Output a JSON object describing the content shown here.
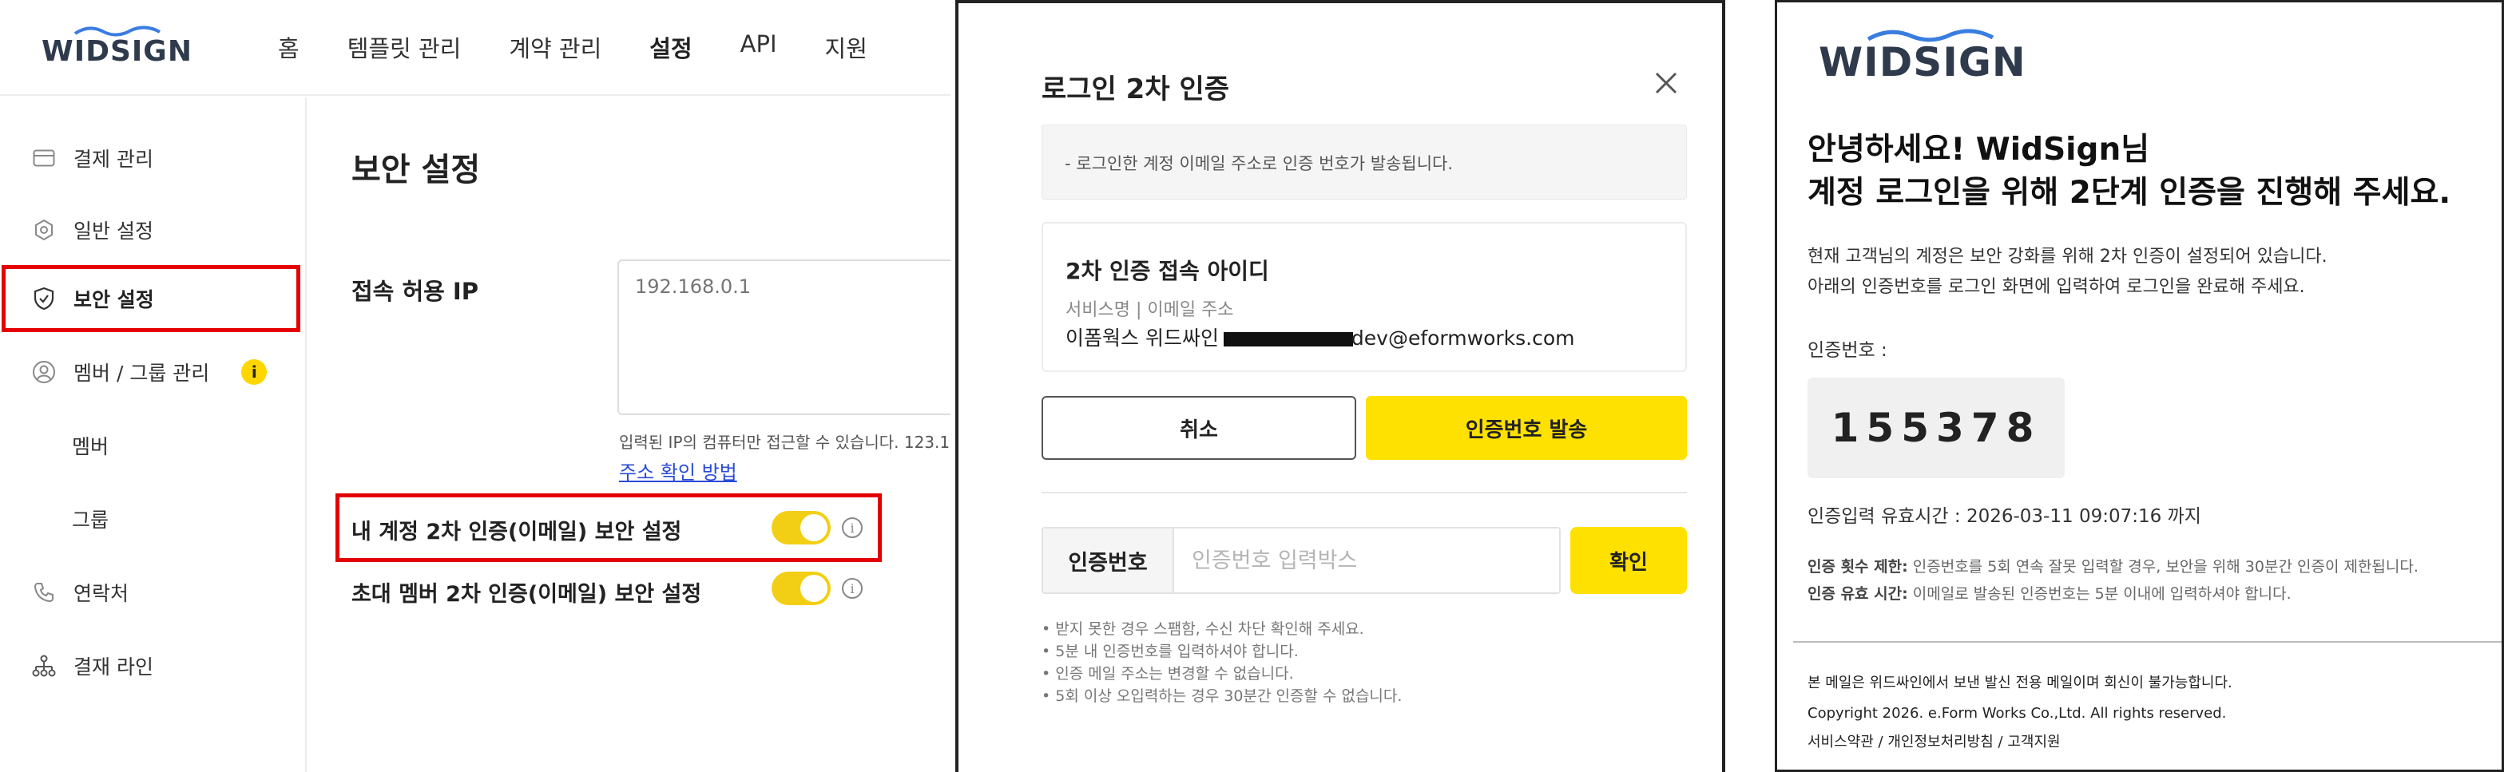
{
  "brand": {
    "name": "WIDSIGN",
    "wave_color": "#3a7de0",
    "accent": "#ffe100",
    "highlight": "#e50000"
  },
  "admin": {
    "nav": [
      "홈",
      "템플릿 관리",
      "계약 관리",
      "설정",
      "API",
      "지원"
    ],
    "nav_active": "설정",
    "sidebar": [
      {
        "label": "결제 관리",
        "icon": "card-icon"
      },
      {
        "label": "일반 설정",
        "icon": "gear-icon"
      },
      {
        "label": "보안 설정",
        "icon": "shield-icon",
        "active": true
      },
      {
        "label": "멤버 / 그룹 관리",
        "icon": "person-icon",
        "badge": "i"
      },
      {
        "label": "멤버"
      },
      {
        "label": "그룹"
      },
      {
        "label": "연락처",
        "icon": "phone-icon"
      },
      {
        "label": "결재 라인",
        "icon": "org-chart-icon"
      }
    ],
    "page_title": "보안 설정",
    "ip_label": "접속 허용 IP",
    "ip_placeholder": "192.168.0.1",
    "ip_help": "입력된 IP의 컴퓨터만 접근할 수 있습니다. 123.1",
    "ip_link": "주소 확인 방법",
    "setting_my_2fa": "내 계정 2차 인증(이메일) 보안 설정",
    "setting_my_2fa_on": true,
    "setting_invite_2fa": "초대 멤버 2차 인증(이메일) 보안 설정",
    "setting_invite_2fa_on": true
  },
  "modal": {
    "title": "로그인 2차 인증",
    "notice": "- 로그인한 계정 이메일 주소로 인증 번호가 발송됩니다.",
    "card_title": "2차 인증 접속 아이디",
    "card_sub": "서비스명 | 이메일 주소",
    "card_service": "이폼웍스 위드싸인",
    "card_email_visible": "dev@eformworks.com",
    "cancel_label": "취소",
    "send_label": "인증번호 발송",
    "code_label": "인증번호",
    "code_placeholder": "인증번호 입력박스",
    "confirm_label": "확인",
    "notes": [
      "• 받지 못한 경우 스팸함, 수신 차단 확인해 주세요.",
      "• 5분 내 인증번호를 입력하셔야 합니다.",
      "• 인증 메일 주소는 변경할 수 없습니다.",
      "• 5회 이상 오입력하는 경우 30분간 인증할 수 없습니다."
    ]
  },
  "email": {
    "greeting_line1": "안녕하세요! WidSign님",
    "greeting_line2": "계정 로그인을 위해 2단계 인증을 진행해 주세요.",
    "body_line1": "현재 고객님의 계정은 보안 강화를 위해 2차 인증이 설정되어 있습니다.",
    "body_line2": "아래의 인증번호를 로그인 화면에 입력하여 로그인을 완료해 주세요.",
    "code_label": "인증번호 :",
    "code": "155378",
    "valid_until": "인증입력 유효시간 : 2026-03-11 09:07:16 까지",
    "rule1_title": "인증 횟수 제한:",
    "rule1_text": " 인증번호를 5회 연속 잘못 입력할 경우, 보안을 위해 30분간 인증이 제한됩니다.",
    "rule2_title": "인증 유효 시간:",
    "rule2_text": " 이메일로 발송된 인증번호는 5분 이내에 입력하셔야 합니다.",
    "footer_notice": "본 메일은 위드싸인에서 보낸 발신 전용 메일이며 회신이 불가능합니다.",
    "copyright": "Copyright 2026. e.Form Works Co.,Ltd. All rights reserved.",
    "footer_links": [
      "서비스약관",
      "개인정보처리방침",
      "고객지원"
    ]
  }
}
